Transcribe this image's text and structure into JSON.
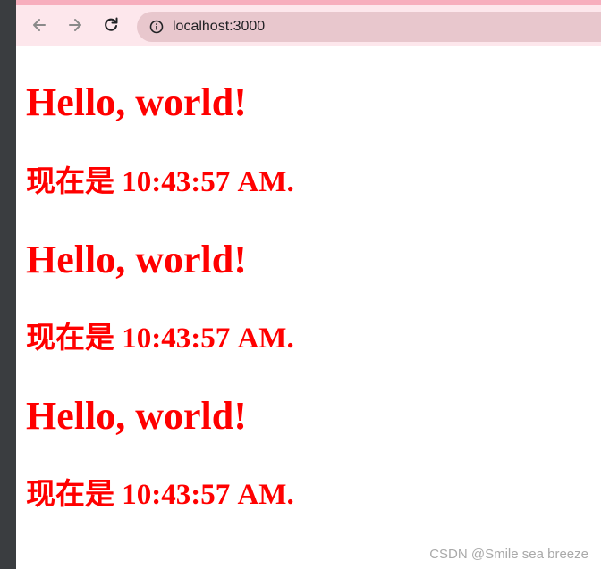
{
  "browser": {
    "url": "localhost:3000",
    "icons": [
      "back-arrow-icon",
      "forward-arrow-icon",
      "reload-icon",
      "info-icon"
    ]
  },
  "content": {
    "blocks": [
      {
        "heading": "Hello, world!",
        "time_text": "现在是 10:43:57 AM."
      },
      {
        "heading": "Hello, world!",
        "time_text": "现在是 10:43:57 AM."
      },
      {
        "heading": "Hello, world!",
        "time_text": "现在是 10:43:57 AM."
      }
    ],
    "text_color": "#ff0000"
  },
  "watermark": "CSDN @Smile sea breeze"
}
